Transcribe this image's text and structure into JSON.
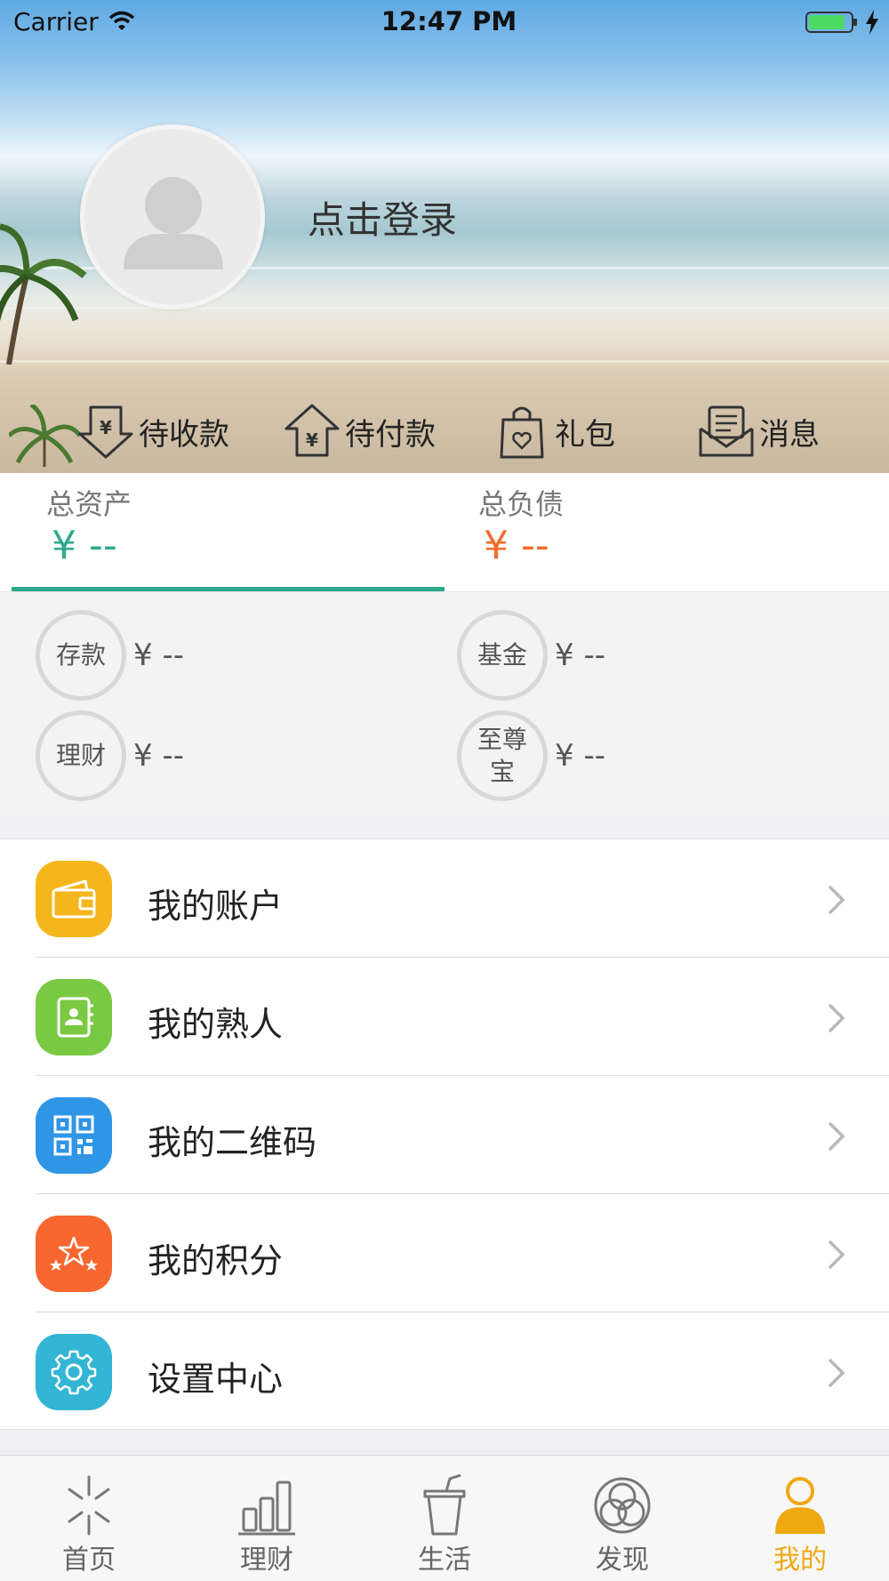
{
  "status_bar": {
    "carrier": "Carrier",
    "time": "12:47 PM"
  },
  "profile": {
    "login_text": "点击登录"
  },
  "quick_actions": [
    {
      "label": "待收款",
      "icon": "receive-payment-icon"
    },
    {
      "label": "待付款",
      "icon": "pending-payment-icon"
    },
    {
      "label": "礼包",
      "icon": "gift-bag-icon"
    },
    {
      "label": "消息",
      "icon": "message-icon"
    }
  ],
  "assets": {
    "total_assets": {
      "label": "总资产",
      "value": "¥ --",
      "color": "#2fa98b"
    },
    "total_liabilities": {
      "label": "总负债",
      "value": "¥ --",
      "color": "#f26d2c"
    },
    "items": [
      {
        "name": "存款",
        "value": "¥ --"
      },
      {
        "name": "基金",
        "value": "¥ --"
      },
      {
        "name": "理财",
        "value": "¥ --"
      },
      {
        "name": "至尊宝",
        "value": "¥ --"
      }
    ]
  },
  "menu": [
    {
      "label": "我的账户",
      "icon": "wallet-icon",
      "color": "#f5b61b"
    },
    {
      "label": "我的熟人",
      "icon": "contacts-icon",
      "color": "#7ac943"
    },
    {
      "label": "我的二维码",
      "icon": "qr-code-icon",
      "color": "#2f96e6"
    },
    {
      "label": "我的积分",
      "icon": "stars-icon",
      "color": "#f7672f"
    },
    {
      "label": "设置中心",
      "icon": "gear-icon",
      "color": "#33b5d5"
    }
  ],
  "tab_bar": {
    "active_color": "#f0a811",
    "items": [
      {
        "label": "首页",
        "icon": "home-sparkle-icon"
      },
      {
        "label": "理财",
        "icon": "bar-chart-icon"
      },
      {
        "label": "生活",
        "icon": "cup-icon"
      },
      {
        "label": "发现",
        "icon": "discover-icon"
      },
      {
        "label": "我的",
        "icon": "person-icon"
      }
    ]
  }
}
